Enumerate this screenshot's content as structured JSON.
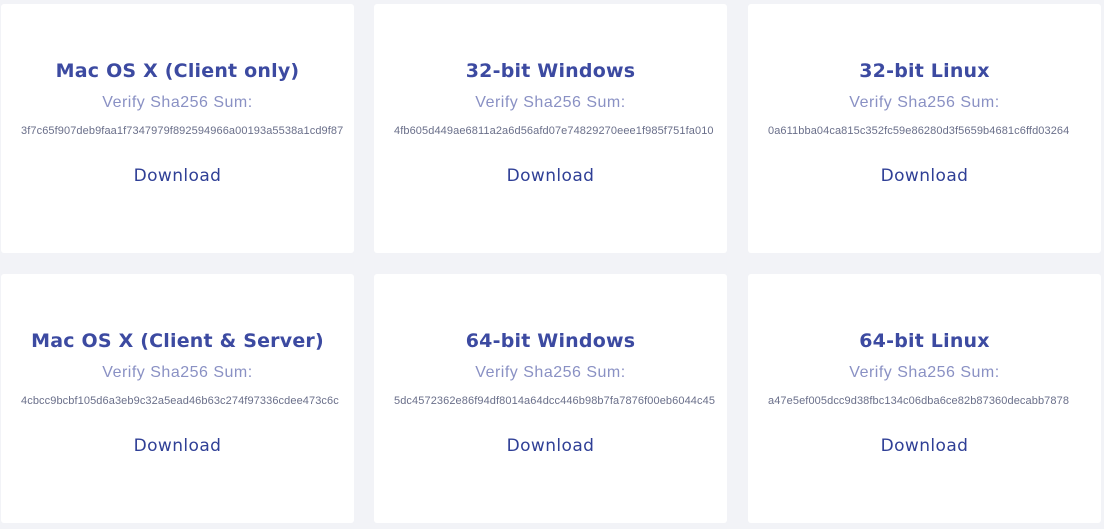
{
  "downloads": [
    {
      "title": "Mac OS X (Client only)",
      "verify_label": "Verify Sha256 Sum:",
      "hash": "3f7c65f907deb9faa1f7347979f892594966a00193a5538a1cd9f87",
      "download_label": "Download"
    },
    {
      "title": "32-bit Windows",
      "verify_label": "Verify Sha256 Sum:",
      "hash": "4fb605d449ae6811a2a6d56afd07e74829270eee1f985f751fa010",
      "download_label": "Download"
    },
    {
      "title": "32-bit Linux",
      "verify_label": "Verify Sha256 Sum:",
      "hash": "0a611bba04ca815c352fc59e86280d3f5659b4681c6ffd03264",
      "download_label": "Download"
    },
    {
      "title": "Mac OS X (Client & Server)",
      "verify_label": "Verify Sha256 Sum:",
      "hash": "4cbcc9bcbf105d6a3eb9c32a5ead46b63c274f97336cdee473c6c",
      "download_label": "Download"
    },
    {
      "title": "64-bit Windows",
      "verify_label": "Verify Sha256 Sum:",
      "hash": "5dc4572362e86f94df8014a64dcc446b98b7fa7876f00eb6044c45",
      "download_label": "Download"
    },
    {
      "title": "64-bit Linux",
      "verify_label": "Verify Sha256 Sum:",
      "hash": "a47e5ef005dcc9d38fbc134c06dba6ce82b87360decabb7878",
      "download_label": "Download"
    }
  ]
}
